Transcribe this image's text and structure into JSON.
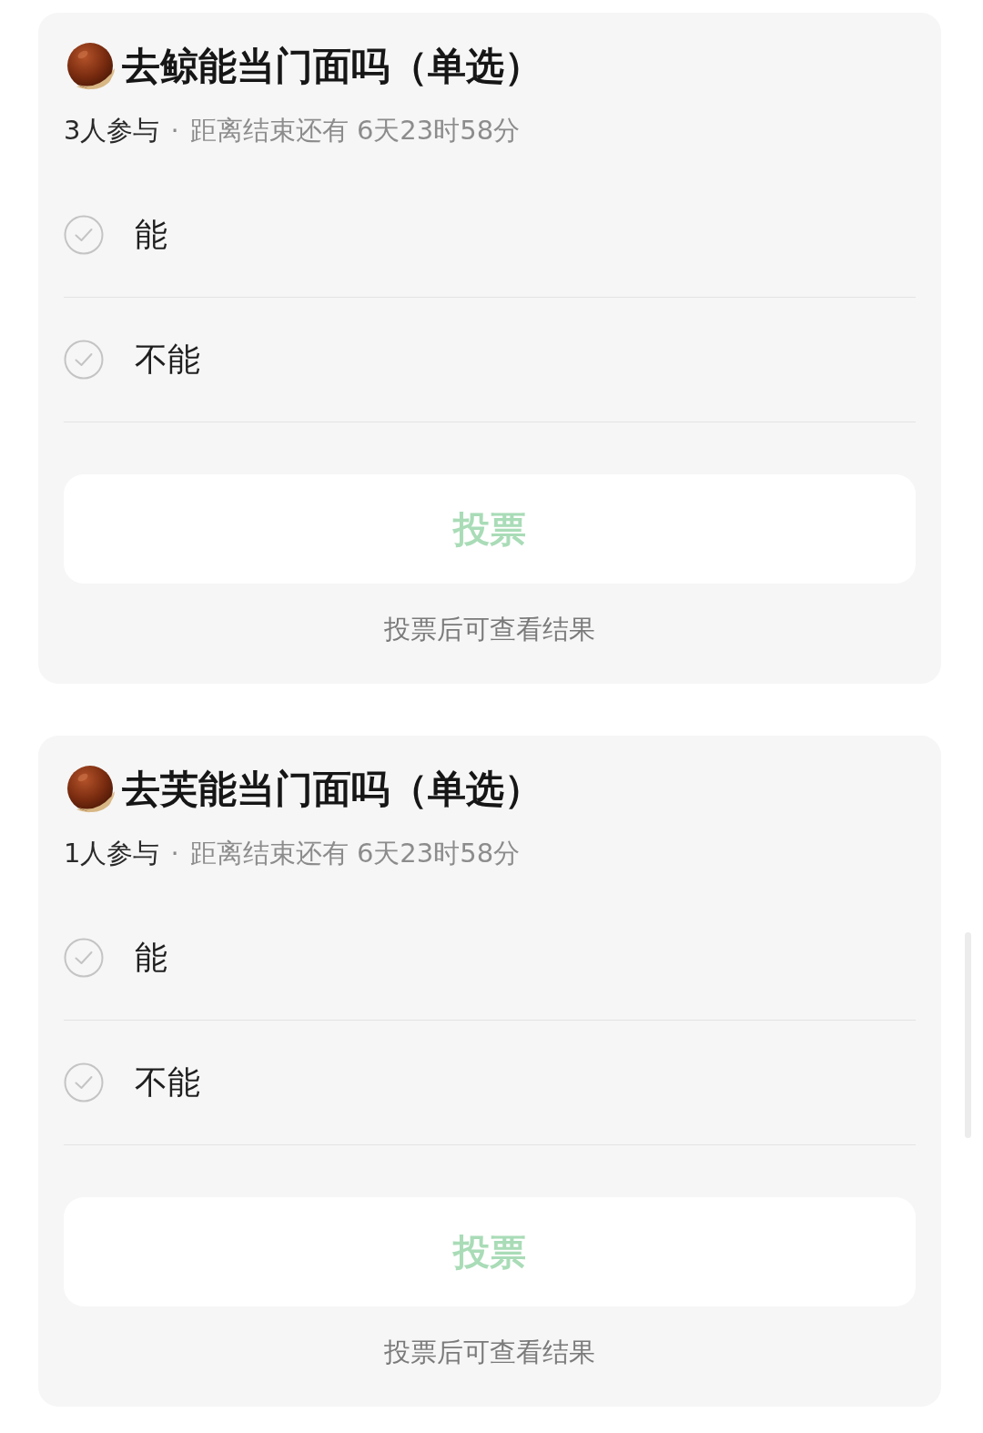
{
  "polls": [
    {
      "title": "去鲸能当门面吗（单选）",
      "participants": "3人参与",
      "separator": "·",
      "countdown": "距离结束还有 6天23时58分",
      "options": [
        {
          "label": "能",
          "selected": false
        },
        {
          "label": "不能",
          "selected": false
        }
      ],
      "vote_button": {
        "label": "投票",
        "disabled": true
      },
      "hint": "投票后可查看结果"
    },
    {
      "title": "去芙能当门面吗（单选）",
      "participants": "1人参与",
      "separator": "·",
      "countdown": "距离结束还有 6天23时58分",
      "options": [
        {
          "label": "能",
          "selected": false
        },
        {
          "label": "不能",
          "selected": false
        }
      ],
      "vote_button": {
        "label": "投票",
        "disabled": true
      },
      "hint": "投票后可查看结果"
    }
  ]
}
